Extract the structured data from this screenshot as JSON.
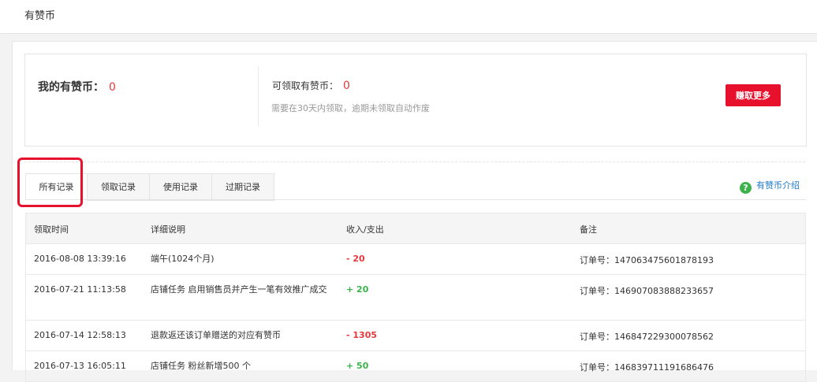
{
  "header": {
    "title": "有赞币"
  },
  "summary": {
    "my_coins_label": "我的有赞币：",
    "my_coins_value": "0",
    "claimable_label": "可领取有赞币：",
    "claimable_value": "0",
    "claim_note": "需要在30天内领取，逾期未领取自动作废",
    "earn_button": "赚取更多"
  },
  "tabs": [
    {
      "label": "所有记录",
      "active": true
    },
    {
      "label": "领取记录",
      "active": false
    },
    {
      "label": "使用记录",
      "active": false
    },
    {
      "label": "过期记录",
      "active": false
    }
  ],
  "intro_link": {
    "icon": "question-circle-icon",
    "label": "有赞币介绍"
  },
  "table": {
    "headers": [
      "领取时间",
      "详细说明",
      "收入/支出",
      "备注"
    ],
    "rows": [
      {
        "time": "2016-08-08 13:39:16",
        "desc": "端午(1024个月)",
        "amount": "- 20",
        "sign": "neg",
        "note": "订单号：147063475601878193"
      },
      {
        "time": "2016-07-21 11:13:58",
        "desc": "店铺任务 启用销售员并产生一笔有效推广成交",
        "amount": "+ 20",
        "sign": "pos",
        "note": "订单号：146907083888233657"
      },
      {
        "time": "2016-07-14 12:58:13",
        "desc": "退款返还该订单赠送的对应有赞币",
        "amount": "- 1305",
        "sign": "neg",
        "note": "订单号：146847229300078562"
      },
      {
        "time": "2016-07-13 16:05:11",
        "desc": "店铺任务 粉丝新增500 个",
        "amount": "+ 50",
        "sign": "pos",
        "note": "订单号：146839711191686476"
      }
    ]
  },
  "colors": {
    "accent_red": "#e8112d",
    "negative": "#e4393c",
    "positive": "#3bb34a",
    "link": "#1e7acb"
  }
}
